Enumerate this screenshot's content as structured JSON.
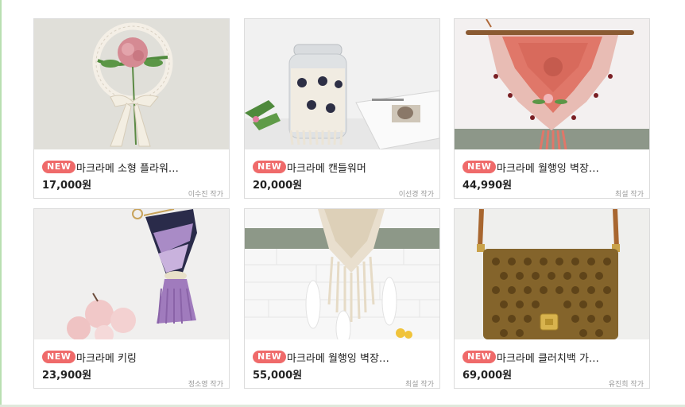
{
  "products": [
    {
      "badge": "NEW",
      "title": "마크라메 소형 플라워…",
      "price": "17,000원",
      "artist": "이수진 작가",
      "image_icon": "macrame-flower-wreath-photo"
    },
    {
      "badge": "NEW",
      "title": "마크라메 캔들워머",
      "price": "20,000원",
      "artist": "이선경 작가",
      "image_icon": "macrame-candle-warmer-photo"
    },
    {
      "badge": "NEW",
      "title": "마크라메 월행잉 벽장…",
      "price": "44,990원",
      "artist": "최설 작가",
      "image_icon": "macrame-wall-hanging-pink-photo"
    },
    {
      "badge": "NEW",
      "title": "마크라메 키링",
      "price": "23,900원",
      "artist": "정소영 작가",
      "image_icon": "macrame-keyring-photo"
    },
    {
      "badge": "NEW",
      "title": "마크라메 월행잉 벽장…",
      "price": "55,000원",
      "artist": "최설 작가",
      "image_icon": "macrame-wall-hanging-feathers-photo"
    },
    {
      "badge": "NEW",
      "title": "마크라메 클러치백 가…",
      "price": "69,000원",
      "artist": "유진희 작가",
      "image_icon": "macrame-clutch-bag-photo"
    }
  ],
  "colors": {
    "badge": "#ef6a6a",
    "border": "#dcdcdc",
    "accent_green": "#b9dfb2"
  }
}
